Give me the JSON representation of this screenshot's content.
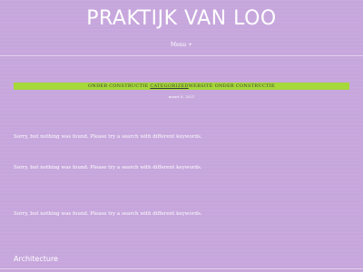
{
  "header": {
    "site_title": "PRAKTIJK VAN LOO",
    "menu_label": "Menu +"
  },
  "post_meta": {
    "prefix": "ONDER CONSTRUCTIE",
    "category_link": "CATEGORIZED",
    "suffix": "WEBSITE ONDER CONSTRUCTIE",
    "date": "maart 8, 2021"
  },
  "notices": [
    "Sorry, but nothing was found. Please try a search with different keywords.",
    "Sorry, but nothing was found. Please try a search with different keywords.",
    "Sorry, but nothing was found. Please try a search with different keywords."
  ],
  "footer": {
    "label": "Architecture"
  },
  "colors": {
    "background": "#c6a6dc",
    "banner": "#a6d839",
    "text": "#ffffff"
  }
}
